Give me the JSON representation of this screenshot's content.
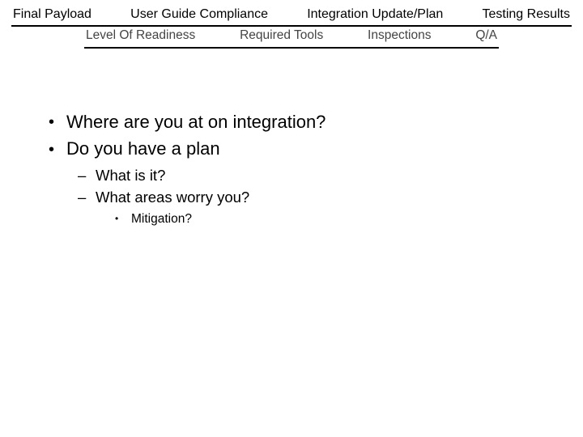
{
  "tabs_row1": {
    "items": [
      "Final Payload",
      "User Guide Compliance",
      "Integration Update/Plan",
      "Testing Results"
    ],
    "active_index": 2
  },
  "tabs_row2": {
    "items": [
      "Level Of Readiness",
      "Required Tools",
      "Inspections",
      "Q/A"
    ]
  },
  "bullets": {
    "level0": [
      "Where are you at on integration?",
      "Do you have a plan"
    ],
    "level1": [
      "What is it?",
      "What areas worry you?"
    ],
    "level2": [
      "Mitigation?"
    ]
  }
}
